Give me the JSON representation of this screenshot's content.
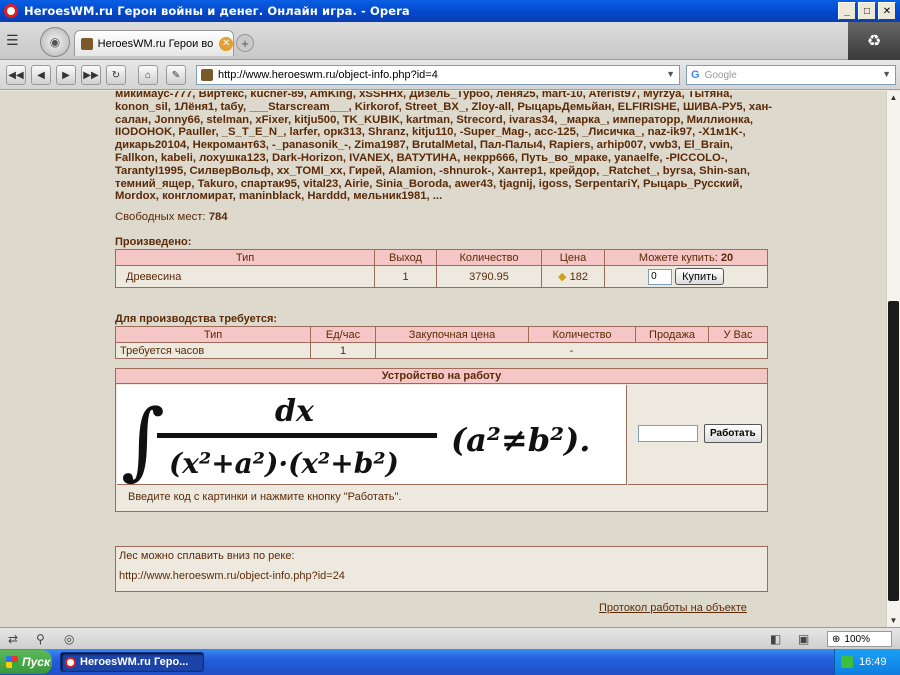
{
  "window": {
    "title": "HeroesWM.ru Герон войны и денег. Онлайн игра. - Opera",
    "buttons": {
      "minimize": "_",
      "maximize": "□",
      "close": "✕"
    }
  },
  "browser": {
    "tab_label": "HeroesWM.ru Герои во...",
    "url": "http://www.heroeswm.ru/object-info.php?id=4",
    "search_placeholder": "Google",
    "search_engine_icon": "G",
    "zoom": "100%"
  },
  "page": {
    "players_text": "микимаус-777, Виртекс, kucher-89, AmKing, xSSHHx, Дизель_Турбо, лёня25, mart-10, Aferist97, Myrzya, Тытяна, konon_sil, 1Лёня1, taбy, ___Starscream___, Kirkorof, Street_BX_, Zloy-all, РыцарьДемьйан, ELFIRISHE, ШИВА-РУ5, хан-салан, Jonny66, stelman, xFixer, kitju500, TK_KUBIK, kartman, Strecord, ivaras34, _марка_, императорр, Миллионка, IIODOHOK, Pauller, _S_T_E_N_, larfer, орк313, Shranz, kitju110, -Super_Mag-, acc-125, _Лисичка_, naz-ik97, -X1м1K-, дикарь20104, Некромант63, -_panasonik_-, Zima1987, BrutalMetal, Пал-Палы4, Rapiers, arhip007, vwb3, El_Brain, Fallkon, kabeli, лохушка123, Dark-Horizon, IVANEX, ВАТУТИНА, некрр666, Путь_во_мраке, yanaelfe, -PICCOLO-, Tarantyl1995, СилверВольф, xx_TOMI_xx, Гирей, Alamion, -shnurok-, Хантер1, крейдор, _Ratchet_, byrsa, Shin-san, темний_ящер, Takuro, спартак95, vital23, Airie, Sinia_Boroda, awer43, tjagnij, igoss, SerpentariY, Рыцарь_Русский, Mordox, конгломират, maninblack, Harddd, мельник1981, ...",
    "free_places_label": "Свободных мест:",
    "free_places_value": "784",
    "produced": {
      "title": "Произведено:",
      "headers": {
        "type": "Тип",
        "output": "Выход",
        "quantity": "Количество",
        "price": "Цена",
        "can_buy_label": "Можете купить:",
        "can_buy_value": "20"
      },
      "row": {
        "type": "Древесина",
        "output": "1",
        "quantity": "3790.95",
        "price": "182",
        "input_value": "0",
        "buy_button": "Купить"
      }
    },
    "required": {
      "title": "Для производства требуется:",
      "headers": {
        "type": "Тип",
        "per_hour": "Ед/час",
        "purchase_price": "Закупочная цена",
        "quantity": "Количество",
        "sale": "Продажа",
        "you_have": "У Вас"
      },
      "row": {
        "type": "Требуется часов",
        "per_hour": "1",
        "dash": "-"
      }
    },
    "work": {
      "title": "Устройство на работу",
      "button": "Работать",
      "note": "Введите код с картинки и нажмите кнопку \"Работать\"."
    },
    "river": {
      "text": "Лес можно сплавить вниз по реке:",
      "link": "http://www.heroeswm.ru/object-info.php?id=24"
    },
    "protocol_link": "Протокол работы на объекте"
  },
  "taskbar": {
    "start": "Пуск",
    "task": "HeroesWM.ru Геро...",
    "clock": "16:49"
  }
}
